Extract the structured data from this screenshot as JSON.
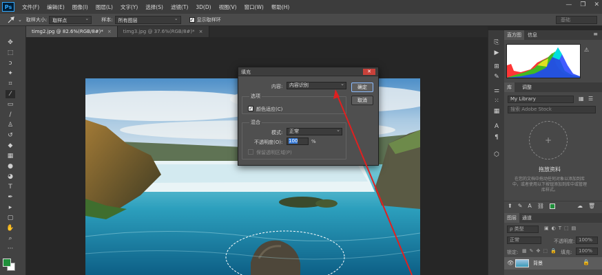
{
  "menubar": {
    "logo": "Ps",
    "items": [
      "文件(F)",
      "编辑(E)",
      "图像(I)",
      "图层(L)",
      "文字(Y)",
      "选择(S)",
      "滤镜(T)",
      "3D(D)",
      "视图(V)",
      "窗口(W)",
      "帮助(H)"
    ],
    "controls": [
      "—",
      "❐",
      "✕"
    ]
  },
  "options": {
    "sample_size_label": "取样大小:",
    "sample_size_value": "取样点",
    "sample_label": "样本:",
    "sample_value": "所有图层",
    "show_ring_label": "显示取样环",
    "search_text": "基础"
  },
  "tabs": [
    {
      "label": "timg2.jpg @ 82.6%(RGB/8#)*",
      "close": "×"
    },
    {
      "label": "timg3.jpg @ 37.6%(RGB/8#)*",
      "close": "×"
    }
  ],
  "dialog": {
    "title": "填充",
    "content_label": "内容:",
    "content_value": "内容识别",
    "ok": "确定",
    "cancel": "取消",
    "options_legend": "选项",
    "color_adapt": "颜色适应(C)",
    "blend_legend": "混合",
    "mode_label": "模式:",
    "mode_value": "正常",
    "opacity_label": "不透明度(O):",
    "opacity_value": "100",
    "opacity_unit": "%",
    "preserve_label": "保留透明区域(P)"
  },
  "panels": {
    "histogram_tabs": [
      "直方图",
      "信息"
    ],
    "library_tabs": [
      "库",
      "调整"
    ],
    "library_select": "My Library",
    "library_search": "搜索 Adobe Stock",
    "drag_title": "拖放资料",
    "drag_desc": "在您的文档中拖动任何对象以添加到库中，或者使用以下按钮添加到库中或管理库样式。",
    "layers_tabs": [
      "图层",
      "通道"
    ],
    "layer_kind": "ρ 类型",
    "blend_mode": "正常",
    "opacity_label": "不透明度:",
    "opacity_value": "100%",
    "lock_label": "锁定:",
    "fill_label": "填充:",
    "fill_value": "100%",
    "layer_name": "背景"
  },
  "colors": {
    "accent": "#31a8ff",
    "foreground": "#1f8f3a",
    "background": "#ffffff",
    "arrow": "#e02020"
  }
}
